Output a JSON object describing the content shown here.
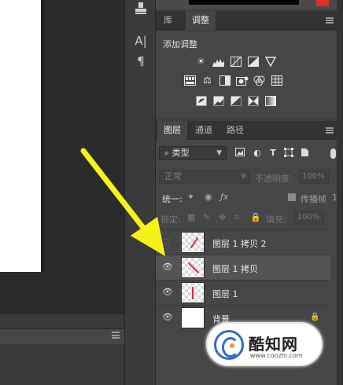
{
  "adjustments_panel": {
    "tabs": [
      {
        "label": "库"
      },
      {
        "label": "调整"
      }
    ],
    "title": "添加调整",
    "icons": [
      "brightness-icon",
      "levels-icon",
      "curves-icon",
      "exposure-icon",
      "vibrance-icon",
      "hue-saturation-icon",
      "color-balance-icon",
      "black-white-icon",
      "photo-filter-icon",
      "channel-mixer-icon",
      "color-lookup-icon",
      "invert-icon",
      "posterize-icon",
      "threshold-icon",
      "selective-color-icon",
      "gradient-map-icon"
    ]
  },
  "layers_panel": {
    "tabs": [
      {
        "label": "图层"
      },
      {
        "label": "通道"
      },
      {
        "label": "路径"
      }
    ],
    "filter": {
      "label": "类型"
    },
    "blend_mode": "正常",
    "opacity_label": "不透明度:",
    "opacity_value": "100%",
    "unify_label": "统一:",
    "propagate_label": "传播帧",
    "propagate_value": "1",
    "lock_label": "锁定:",
    "fill_label": "填充:",
    "fill_value": "100%",
    "layers": [
      {
        "name": "图层 1 拷贝 2",
        "visible": false,
        "selected": false
      },
      {
        "name": "图层 1 拷贝",
        "visible": true,
        "selected": true
      },
      {
        "name": "图层 1",
        "visible": true,
        "selected": false
      },
      {
        "name": "背景",
        "visible": true,
        "selected": false,
        "locked": true
      }
    ]
  },
  "tools": {
    "type_tool": "A|",
    "paragraph_tool": "¶"
  },
  "watermark": {
    "title": "酷知网",
    "url": "www.coozhi.com"
  },
  "colors": {
    "arrow": "#f7f21a",
    "stroke_red": "#d92d3b",
    "logo_blue": "#2b6fc4"
  }
}
